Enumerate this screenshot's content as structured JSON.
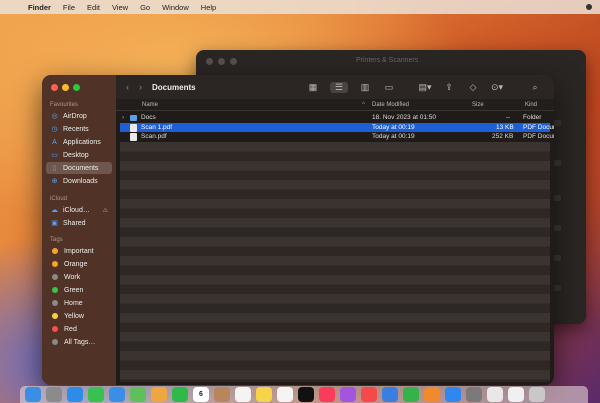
{
  "menubar": {
    "items": [
      "Finder",
      "File",
      "Edit",
      "View",
      "Go",
      "Window",
      "Help"
    ]
  },
  "bg_window": {
    "title": "Printers & Scanners"
  },
  "finder": {
    "toolbar": {
      "title": "Documents"
    },
    "sidebar": {
      "favourites_label": "Favourites",
      "favourites": [
        "AirDrop",
        "Recents",
        "Applications",
        "Desktop",
        "Documents",
        "Downloads"
      ],
      "icloud_label": "iCloud",
      "icloud": [
        "iCloud…",
        "Shared"
      ],
      "tags_label": "Tags",
      "tags": [
        {
          "label": "Important",
          "color": "#f5a623"
        },
        {
          "label": "Orange",
          "color": "#f5a623"
        },
        {
          "label": "Work",
          "color": "#8a8a8a"
        },
        {
          "label": "Green",
          "color": "#3cc24a"
        },
        {
          "label": "Home",
          "color": "#8a8a8a"
        },
        {
          "label": "Yellow",
          "color": "#f3d33b"
        },
        {
          "label": "Red",
          "color": "#ff4d4d"
        },
        {
          "label": "All Tags…",
          "color": "#888888"
        }
      ]
    },
    "columns": {
      "name": "Name",
      "date": "Date Modified",
      "size": "Size",
      "kind": "Kind"
    },
    "files": [
      {
        "name": "Docs",
        "date": "18. Nov 2023 at 01:50",
        "size": "--",
        "kind": "Folder",
        "type": "folder"
      },
      {
        "name": "Scan 1.pdf",
        "date": "Today at 00:19",
        "size": "13 KB",
        "kind": "PDF Document",
        "type": "doc"
      },
      {
        "name": "Scan.pdf",
        "date": "Today at 00:19",
        "size": "252 KB",
        "kind": "PDF Document",
        "type": "doc"
      }
    ]
  },
  "dock": {
    "calendar_day": "6",
    "apps": [
      {
        "icon": "finder-icon",
        "color": "#3a8ee6"
      },
      {
        "icon": "launchpad-icon",
        "color": "#8b8b8b"
      },
      {
        "icon": "safari-icon",
        "color": "#2b8de8"
      },
      {
        "icon": "messages-icon",
        "color": "#37c24f"
      },
      {
        "icon": "mail-icon",
        "color": "#3a8ee6"
      },
      {
        "icon": "maps-icon",
        "color": "#5fbf5a"
      },
      {
        "icon": "photos-icon",
        "color": "#f0a640"
      },
      {
        "icon": "facetime-icon",
        "color": "#2fb94a"
      },
      {
        "icon": "calendar-icon",
        "color": "#ffffff"
      },
      {
        "icon": "contacts-icon",
        "color": "#b8865a"
      },
      {
        "icon": "reminders-icon",
        "color": "#f4f4f4"
      },
      {
        "icon": "notes-icon",
        "color": "#f7d34a"
      },
      {
        "icon": "freeform-icon",
        "color": "#f4f4f4"
      },
      {
        "icon": "tv-icon",
        "color": "#111111"
      },
      {
        "icon": "music-icon",
        "color": "#fa3c5a"
      },
      {
        "icon": "podcasts-icon",
        "color": "#a455e0"
      },
      {
        "icon": "news-icon",
        "color": "#f54a4a"
      },
      {
        "icon": "keynote-icon",
        "color": "#3a7fe0"
      },
      {
        "icon": "numbers-icon",
        "color": "#35b34a"
      },
      {
        "icon": "pages-icon",
        "color": "#f08a2a"
      },
      {
        "icon": "appstore-icon",
        "color": "#2f88f0"
      },
      {
        "icon": "settings-icon",
        "color": "#7a7a7a"
      },
      {
        "icon": "chrome-icon",
        "color": "#e8e8e8"
      },
      {
        "icon": "textedit-icon",
        "color": "#f0f0f0"
      },
      {
        "icon": "trash-icon",
        "color": "#c8c8c8"
      }
    ]
  }
}
